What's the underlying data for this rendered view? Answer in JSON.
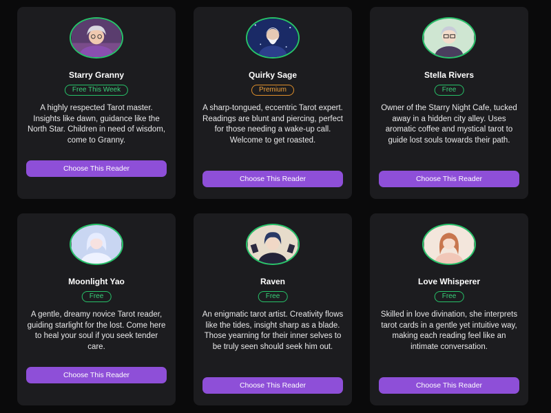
{
  "readers": [
    {
      "name": "Starry Granny",
      "badge": "Free This Week",
      "badge_type": "green",
      "description": "A highly respected Tarot master. Insights like dawn, guidance like the North Star. Children in need of wisdom, come to Granny.",
      "button": "Choose This Reader",
      "avatar_icon": "elderly-woman-portrait-icon"
    },
    {
      "name": "Quirky Sage",
      "badge": "Premium",
      "badge_type": "amber",
      "description": "A sharp-tongued, eccentric Tarot expert. Readings are blunt and piercing, perfect for those needing a wake-up call. Welcome to get roasted.",
      "button": "Choose This Reader",
      "avatar_icon": "bearded-sage-portrait-icon"
    },
    {
      "name": "Stella Rivers",
      "badge": "Free",
      "badge_type": "green",
      "description": "Owner of the Starry Night Cafe, tucked away in a hidden city alley. Uses aromatic coffee and mystical tarot to guide lost souls towards their path.",
      "button": "Choose This Reader",
      "avatar_icon": "silver-haired-man-portrait-icon"
    },
    {
      "name": "Moonlight Yao",
      "badge": "Free",
      "badge_type": "green",
      "description": "A gentle, dreamy novice Tarot reader, guiding starlight for the lost. Come here to heal your soul if you seek tender care.",
      "button": "Choose This Reader",
      "avatar_icon": "dreamy-girl-portrait-icon"
    },
    {
      "name": "Raven",
      "badge": "Free",
      "badge_type": "green",
      "description": "An enigmatic tarot artist. Creativity flows like the tides, insight sharp as a blade. Those yearning for their inner selves to be truly seen should seek him out.",
      "button": "Choose This Reader",
      "avatar_icon": "dark-haired-man-portrait-icon"
    },
    {
      "name": "Love Whisperer",
      "badge": "Free",
      "badge_type": "green",
      "description": "Skilled in love divination, she interprets tarot cards in a gentle yet intuitive way, making each reading feel like an intimate conversation.",
      "button": "Choose This Reader",
      "avatar_icon": "auburn-haired-woman-portrait-icon"
    }
  ]
}
